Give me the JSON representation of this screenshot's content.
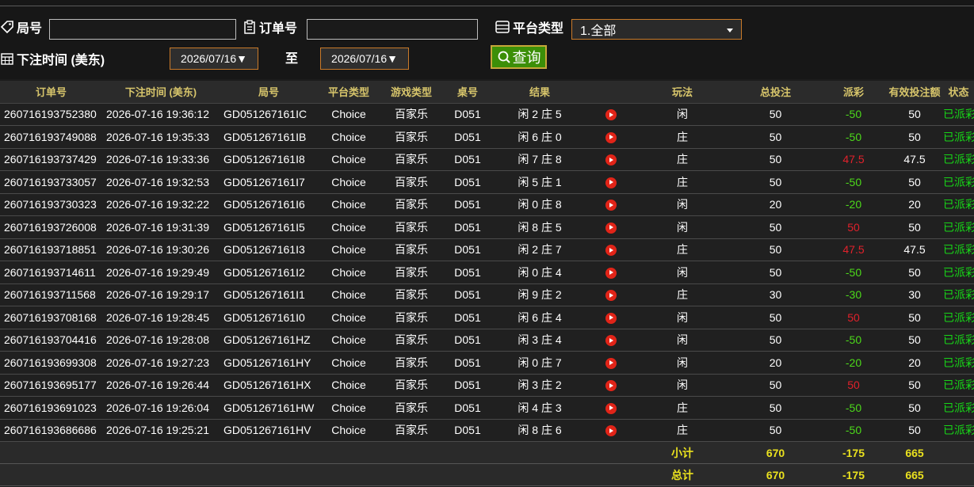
{
  "filters": {
    "round_label": "局号",
    "round_value": "",
    "order_label": "订单号",
    "order_value": "",
    "platform_label": "平台类型",
    "platform_selected": "1.全部",
    "time_label": "下注时间 (美东)",
    "date_from": "2026/07/16▼",
    "to_label": "至",
    "date_to": "2026/07/16▼",
    "query_label": "查询"
  },
  "table": {
    "headers": [
      "订单号",
      "下注时间 (美东)",
      "局号",
      "平台类型",
      "游戏类型",
      "桌号",
      "结果",
      "",
      "玩法",
      "总投注",
      "派彩",
      "有效投注额",
      "状态"
    ],
    "rows": [
      {
        "order": "260716193752380",
        "time": "2026-07-16 19:36:12",
        "round": "GD051267161IC",
        "platform": "Choice",
        "game": "百家乐",
        "table": "D051",
        "result": "闲 2 庄 5",
        "play": "闲",
        "bet": "50",
        "payout": "-50",
        "payout_kind": "neg",
        "valid": "50",
        "status": "已派彩"
      },
      {
        "order": "260716193749088",
        "time": "2026-07-16 19:35:33",
        "round": "GD051267161IB",
        "platform": "Choice",
        "game": "百家乐",
        "table": "D051",
        "result": "闲 6 庄 0",
        "play": "庄",
        "bet": "50",
        "payout": "-50",
        "payout_kind": "neg",
        "valid": "50",
        "status": "已派彩"
      },
      {
        "order": "260716193737429",
        "time": "2026-07-16 19:33:36",
        "round": "GD051267161I8",
        "platform": "Choice",
        "game": "百家乐",
        "table": "D051",
        "result": "闲 7 庄 8",
        "play": "庄",
        "bet": "50",
        "payout": "47.5",
        "payout_kind": "pos",
        "valid": "47.5",
        "status": "已派彩"
      },
      {
        "order": "260716193733057",
        "time": "2026-07-16 19:32:53",
        "round": "GD051267161I7",
        "platform": "Choice",
        "game": "百家乐",
        "table": "D051",
        "result": "闲 5 庄 1",
        "play": "庄",
        "bet": "50",
        "payout": "-50",
        "payout_kind": "neg",
        "valid": "50",
        "status": "已派彩"
      },
      {
        "order": "260716193730323",
        "time": "2026-07-16 19:32:22",
        "round": "GD051267161I6",
        "platform": "Choice",
        "game": "百家乐",
        "table": "D051",
        "result": "闲 0 庄 8",
        "play": "闲",
        "bet": "20",
        "payout": "-20",
        "payout_kind": "neg",
        "valid": "20",
        "status": "已派彩"
      },
      {
        "order": "260716193726008",
        "time": "2026-07-16 19:31:39",
        "round": "GD051267161I5",
        "platform": "Choice",
        "game": "百家乐",
        "table": "D051",
        "result": "闲 8 庄 5",
        "play": "闲",
        "bet": "50",
        "payout": "50",
        "payout_kind": "pos",
        "valid": "50",
        "status": "已派彩"
      },
      {
        "order": "260716193718851",
        "time": "2026-07-16 19:30:26",
        "round": "GD051267161I3",
        "platform": "Choice",
        "game": "百家乐",
        "table": "D051",
        "result": "闲 2 庄 7",
        "play": "庄",
        "bet": "50",
        "payout": "47.5",
        "payout_kind": "pos",
        "valid": "47.5",
        "status": "已派彩"
      },
      {
        "order": "260716193714611",
        "time": "2026-07-16 19:29:49",
        "round": "GD051267161I2",
        "platform": "Choice",
        "game": "百家乐",
        "table": "D051",
        "result": "闲 0 庄 4",
        "play": "闲",
        "bet": "50",
        "payout": "-50",
        "payout_kind": "neg",
        "valid": "50",
        "status": "已派彩"
      },
      {
        "order": "260716193711568",
        "time": "2026-07-16 19:29:17",
        "round": "GD051267161I1",
        "platform": "Choice",
        "game": "百家乐",
        "table": "D051",
        "result": "闲 9 庄 2",
        "play": "庄",
        "bet": "30",
        "payout": "-30",
        "payout_kind": "neg",
        "valid": "30",
        "status": "已派彩"
      },
      {
        "order": "260716193708168",
        "time": "2026-07-16 19:28:45",
        "round": "GD051267161I0",
        "platform": "Choice",
        "game": "百家乐",
        "table": "D051",
        "result": "闲 6 庄 4",
        "play": "闲",
        "bet": "50",
        "payout": "50",
        "payout_kind": "pos",
        "valid": "50",
        "status": "已派彩"
      },
      {
        "order": "260716193704416",
        "time": "2026-07-16 19:28:08",
        "round": "GD051267161HZ",
        "platform": "Choice",
        "game": "百家乐",
        "table": "D051",
        "result": "闲 3 庄 4",
        "play": "闲",
        "bet": "50",
        "payout": "-50",
        "payout_kind": "neg",
        "valid": "50",
        "status": "已派彩"
      },
      {
        "order": "260716193699308",
        "time": "2026-07-16 19:27:23",
        "round": "GD051267161HY",
        "platform": "Choice",
        "game": "百家乐",
        "table": "D051",
        "result": "闲 0 庄 7",
        "play": "闲",
        "bet": "20",
        "payout": "-20",
        "payout_kind": "neg",
        "valid": "20",
        "status": "已派彩"
      },
      {
        "order": "260716193695177",
        "time": "2026-07-16 19:26:44",
        "round": "GD051267161HX",
        "platform": "Choice",
        "game": "百家乐",
        "table": "D051",
        "result": "闲 3 庄 2",
        "play": "闲",
        "bet": "50",
        "payout": "50",
        "payout_kind": "pos",
        "valid": "50",
        "status": "已派彩"
      },
      {
        "order": "260716193691023",
        "time": "2026-07-16 19:26:04",
        "round": "GD051267161HW",
        "platform": "Choice",
        "game": "百家乐",
        "table": "D051",
        "result": "闲 4 庄 3",
        "play": "庄",
        "bet": "50",
        "payout": "-50",
        "payout_kind": "neg",
        "valid": "50",
        "status": "已派彩"
      },
      {
        "order": "260716193686686",
        "time": "2026-07-16 19:25:21",
        "round": "GD051267161HV",
        "platform": "Choice",
        "game": "百家乐",
        "table": "D051",
        "result": "闲 8 庄 6",
        "play": "庄",
        "bet": "50",
        "payout": "-50",
        "payout_kind": "neg",
        "valid": "50",
        "status": "已派彩"
      }
    ],
    "subtotal": {
      "label": "小计",
      "bet": "670",
      "payout": "-175",
      "valid": "665"
    },
    "total": {
      "label": "总计",
      "bet": "670",
      "payout": "-175",
      "valid": "665"
    }
  },
  "colors": {
    "positive_payout": "#e1212b",
    "negative_payout": "#4cd91a",
    "status": "#17d617",
    "header_text": "#d7c56b",
    "sum_text": "#eae11e",
    "accent_border": "#c97a2a",
    "query_bg": "#3c8f08"
  },
  "icons": {
    "round": "tag-icon",
    "order": "clipboard-icon",
    "platform": "list-icon",
    "time": "calendar-icon",
    "query": "search-icon",
    "replay": "play-icon"
  }
}
